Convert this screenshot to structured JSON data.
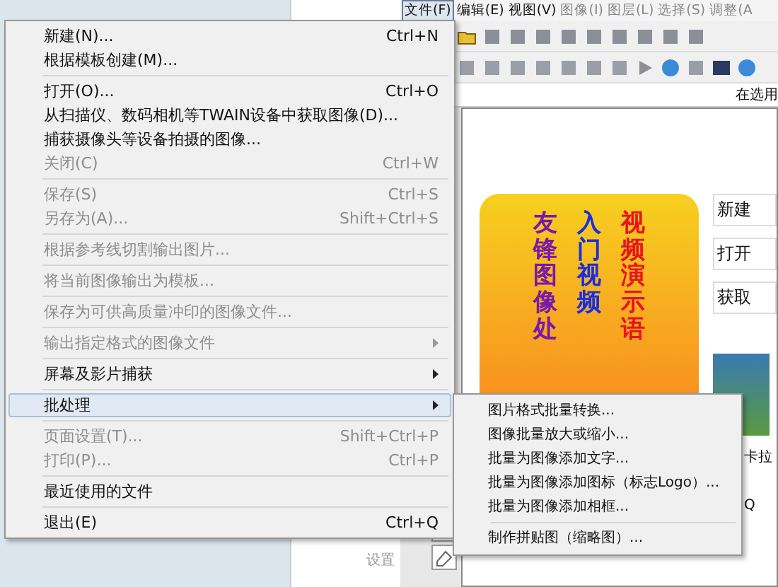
{
  "menubar": [
    {
      "label": "文件(F)",
      "selected": true,
      "disabled": false
    },
    {
      "label": "编辑(E)",
      "selected": false,
      "disabled": false
    },
    {
      "label": "视图(V)",
      "selected": false,
      "disabled": false
    },
    {
      "label": "图像(I)",
      "selected": false,
      "disabled": true
    },
    {
      "label": "图层(L)",
      "selected": false,
      "disabled": true
    },
    {
      "label": "选择(S)",
      "selected": false,
      "disabled": true
    },
    {
      "label": "调整(A",
      "selected": false,
      "disabled": true
    }
  ],
  "info_text": "在选用",
  "banner": {
    "columns": [
      {
        "text": "友锋图像处",
        "color": "#7a1aa8"
      },
      {
        "text": "入门视频",
        "color": "#1a2ee0"
      },
      {
        "text": "视频演示语",
        "color": "#e8141c"
      }
    ]
  },
  "side_links": [
    {
      "label": "新建"
    },
    {
      "label": "打开"
    },
    {
      "label": "获取"
    }
  ],
  "side_texts": [
    "卡拉",
    "Q"
  ],
  "hint_text": "设置",
  "file_menu": {
    "items": [
      {
        "kind": "item",
        "label": "新建(N)...",
        "shortcut": "Ctrl+N",
        "disabled": false,
        "submenu": false,
        "selected": false
      },
      {
        "kind": "item",
        "label": "根据模板创建(M)...",
        "disabled": false,
        "submenu": false,
        "selected": false
      },
      {
        "kind": "separator"
      },
      {
        "kind": "item",
        "label": "打开(O)...",
        "shortcut": "Ctrl+O",
        "disabled": false,
        "submenu": false,
        "selected": false
      },
      {
        "kind": "item",
        "label": "从扫描仪、数码相机等TWAIN设备中获取图像(D)...",
        "disabled": false,
        "submenu": false,
        "selected": false
      },
      {
        "kind": "item",
        "label": "捕获摄像头等设备拍摄的图像...",
        "disabled": false,
        "submenu": false,
        "selected": false
      },
      {
        "kind": "item",
        "label": "关闭(C)",
        "shortcut": "Ctrl+W",
        "disabled": true,
        "submenu": false,
        "selected": false
      },
      {
        "kind": "separator"
      },
      {
        "kind": "item",
        "label": "保存(S)",
        "shortcut": "Ctrl+S",
        "disabled": true,
        "submenu": false,
        "selected": false
      },
      {
        "kind": "item",
        "label": "另存为(A)...",
        "shortcut": "Shift+Ctrl+S",
        "disabled": true,
        "submenu": false,
        "selected": false
      },
      {
        "kind": "separator"
      },
      {
        "kind": "item",
        "label": "根据参考线切割输出图片...",
        "disabled": true,
        "submenu": false,
        "selected": false
      },
      {
        "kind": "separator"
      },
      {
        "kind": "item",
        "label": "将当前图像输出为模板...",
        "disabled": true,
        "submenu": false,
        "selected": false
      },
      {
        "kind": "separator"
      },
      {
        "kind": "item",
        "label": "保存为可供高质量冲印的图像文件...",
        "disabled": true,
        "submenu": false,
        "selected": false
      },
      {
        "kind": "separator"
      },
      {
        "kind": "item",
        "label": "输出指定格式的图像文件",
        "disabled": true,
        "submenu": true,
        "selected": false
      },
      {
        "kind": "separator"
      },
      {
        "kind": "item",
        "label": "屏幕及影片捕获",
        "disabled": false,
        "submenu": true,
        "selected": false
      },
      {
        "kind": "separator"
      },
      {
        "kind": "item",
        "label": "批处理",
        "disabled": false,
        "submenu": true,
        "selected": true
      },
      {
        "kind": "separator"
      },
      {
        "kind": "item",
        "label": "页面设置(T)...",
        "shortcut": "Shift+Ctrl+P",
        "disabled": true,
        "submenu": false,
        "selected": false
      },
      {
        "kind": "item",
        "label": "打印(P)...",
        "shortcut": "Ctrl+P",
        "disabled": true,
        "submenu": false,
        "selected": false
      },
      {
        "kind": "separator"
      },
      {
        "kind": "item",
        "label": "最近使用的文件",
        "disabled": false,
        "submenu": false,
        "selected": false
      },
      {
        "kind": "separator"
      },
      {
        "kind": "item",
        "label": "退出(E)",
        "shortcut": "Ctrl+Q",
        "disabled": false,
        "submenu": false,
        "selected": false
      }
    ]
  },
  "batch_submenu": {
    "items": [
      {
        "kind": "item",
        "label": "图片格式批量转换..."
      },
      {
        "kind": "item",
        "label": "图像批量放大或缩小..."
      },
      {
        "kind": "item",
        "label": "批量为图像添加文字..."
      },
      {
        "kind": "item",
        "label": "批量为图像添加图标（标志Logo）..."
      },
      {
        "kind": "item",
        "label": "批量为图像添加相框..."
      },
      {
        "kind": "separator"
      },
      {
        "kind": "item",
        "label": "制作拼贴图（缩略图）..."
      }
    ]
  }
}
